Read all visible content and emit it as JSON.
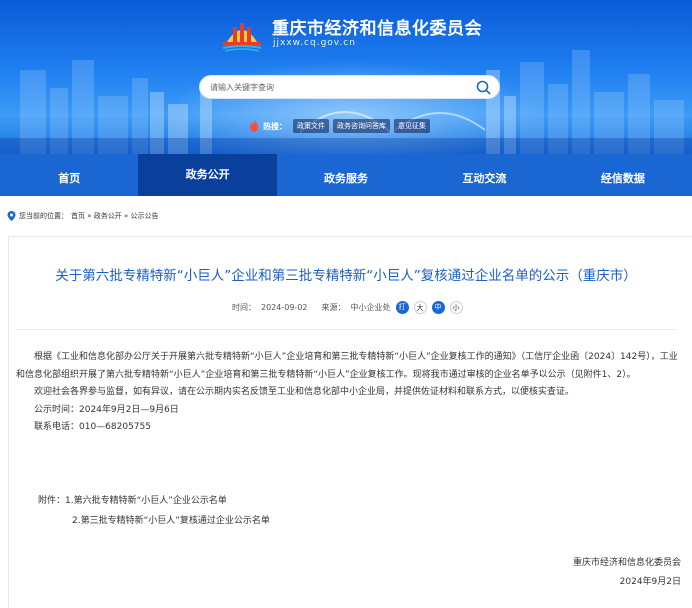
{
  "header": {
    "site_title": "重庆市经济和信息化委员会",
    "site_url": "jjxxw.cq.gov.cn",
    "search_placeholder": "请输入关键字查询",
    "hot_label": "热搜：",
    "hot_tags": [
      "政策文件",
      "政务咨询问答库",
      "意见征集"
    ]
  },
  "nav": {
    "items": [
      "首页",
      "政务公开",
      "政务服务",
      "互动交流",
      "经信数据"
    ],
    "active_index": 1
  },
  "breadcrumb": {
    "prefix": "您当前的位置：",
    "path": "首页 » 政务公开 » 公示公告"
  },
  "article": {
    "title": "关于第六批专精特新“小巨人”企业和第三批专精特新“小巨人”复核通过企业名单的公示（重庆市）",
    "time_label": "时间：",
    "time_value": "2024-09-02",
    "source_label": "来源：",
    "source_value": "中小企业处",
    "font_print": "打",
    "font_large": "大",
    "font_mid": "中",
    "font_small": "小",
    "paragraphs": [
      "根据《工业和信息化部办公厅关于开展第六批专精特新“小巨人”企业培育和第三批专精特新“小巨人”企业复核工作的通知》（工信厅企业函〔2024〕142号），工业和信息化部组织开展了第六批专精特新“小巨人”企业培育和第三批专精特新“小巨人”企业复核工作。现将我市通过审核的企业名单予以公示（见附件1、2）。",
      "欢迎社会各界参与监督，如有异议，请在公示期内实名反馈至工业和信息化部中小企业局，并提供佐证材料和联系方式，以便核实查证。",
      "公示时间：2024年9月2日—9月6日",
      "联系电话：010—68205755"
    ],
    "attachments": [
      "附件：1.第六批专精特新“小巨人”企业公示名单",
      "2.第三批专精特新“小巨人”复核通过企业公示名单"
    ],
    "sign_org": "重庆市经济和信息化委员会",
    "sign_date": "2024年9月2日"
  },
  "colors": {
    "banner_top": "#0a5bd8",
    "nav_bg": "#1a66d3",
    "nav_active": "#0b3f9c",
    "title_blue": "#1a5fc8"
  }
}
